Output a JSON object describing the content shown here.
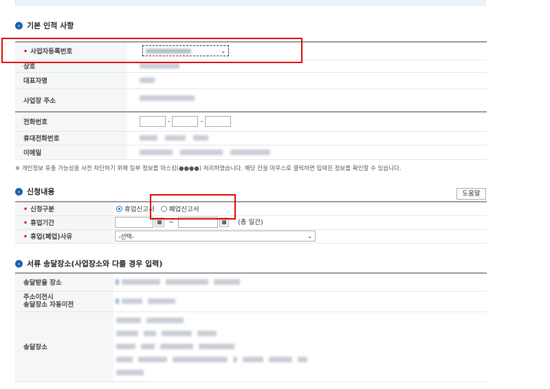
{
  "sections": {
    "basic": "기본 인적 사항",
    "request": "신청내용",
    "delivery": "서류 송달장소(사업장소와 다를 경우 입력)"
  },
  "basic": {
    "biz_reg_label": "사업자등록번호",
    "trade_name_label": "상호",
    "ceo_label": "대표자명",
    "address_label": "사업장 주소",
    "phone_label": "전화번호",
    "phone_dash1": "-",
    "phone_dash2": "-",
    "mobile_label": "휴대전화번호",
    "email_label": "이메일"
  },
  "notice": "※ 개인정보 유출 가능성을 사전 차단하기 위해 일부 정보를 마스킹(●●●●) 처리하였습니다. 해당 칸을 마우스로 클릭하면 입력된 정보를 확인할 수 있습니다.",
  "request": {
    "help_button": "도움말",
    "type_label": "신청구분",
    "option_closure_temp": "휴업신고서",
    "option_closure_perm": "폐업신고서",
    "period_label": "휴업기간",
    "period_sep": "~",
    "period_total": "(총    일간)",
    "reason_label": "휴업(폐업)사유",
    "reason_selected": "-선택-"
  },
  "delivery": {
    "place_label": "송달받을 장소",
    "auto_move_label_1": "주소이전시",
    "auto_move_label_2": "송달장소 자동이전",
    "addr_label": "송달장소"
  },
  "icons": {
    "calendar": "calendar-icon",
    "chevron": "chevron-down-icon",
    "section_bullet": "section-bullet-icon"
  },
  "colors": {
    "highlight_box": "#e00000",
    "accent_blue": "#1b5fab",
    "required": "#d40f0f"
  }
}
